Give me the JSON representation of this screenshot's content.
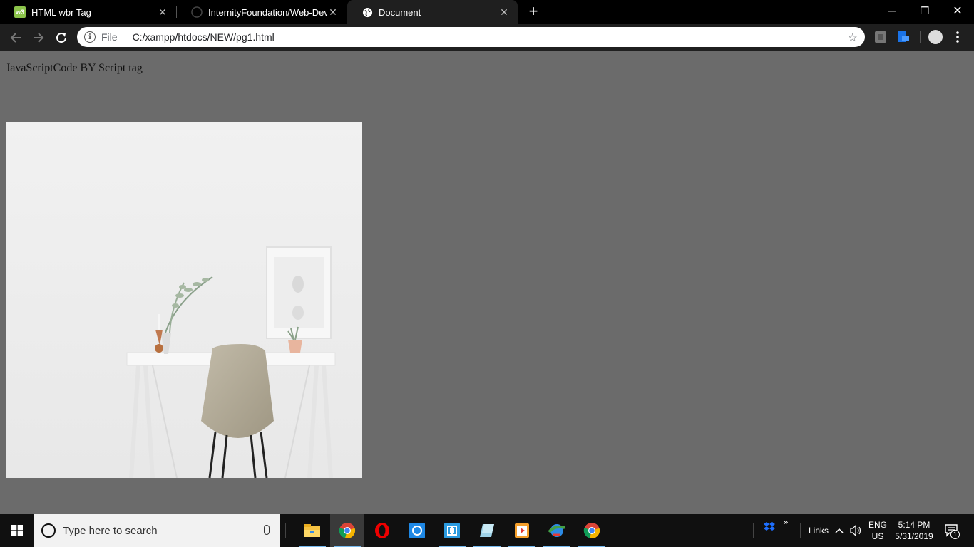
{
  "browser": {
    "tabs": [
      {
        "title": "HTML wbr Tag",
        "favicon": "w3schools-icon",
        "active": false
      },
      {
        "title": "InternityFoundation/Web-Dev-Su",
        "favicon": "github-icon",
        "active": false
      },
      {
        "title": "Document",
        "favicon": "globe-icon",
        "active": true
      }
    ],
    "new_tab": "+",
    "window_controls": {
      "minimize": "─",
      "restore": "❐",
      "close": "✕"
    },
    "address": {
      "scheme": "File",
      "url": "C:/xampp/htdocs/NEW/pg1.html"
    }
  },
  "page": {
    "text": "JavaScriptCode BY Script tag",
    "image_alt": "white desk with chair, plant and picture frame"
  },
  "taskbar": {
    "search_placeholder": "Type here to search",
    "apps": [
      {
        "name": "file-explorer-icon",
        "active": false
      },
      {
        "name": "chrome-icon",
        "active": true
      },
      {
        "name": "opera-icon",
        "active": false
      },
      {
        "name": "sync-app-icon",
        "active": false
      },
      {
        "name": "bracket-app-icon",
        "active": false
      },
      {
        "name": "notes-app-icon",
        "active": false
      },
      {
        "name": "media-player-icon",
        "active": false
      },
      {
        "name": "download-manager-icon",
        "active": false
      },
      {
        "name": "chrome-second-icon",
        "active": false
      }
    ],
    "tray": {
      "links_label": "Links",
      "language": "ENG",
      "region": "US",
      "time": "5:14 PM",
      "date": "5/31/2019",
      "notifications": "1"
    }
  }
}
